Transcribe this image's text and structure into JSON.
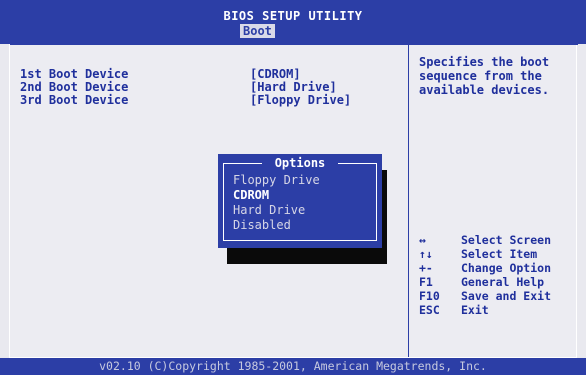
{
  "header": {
    "title": "BIOS SETUP UTILITY",
    "active_tab": "Boot"
  },
  "boot_devices": [
    {
      "label": "1st Boot Device",
      "value": "[CDROM]"
    },
    {
      "label": "2nd Boot Device",
      "value": "[Hard Drive]"
    },
    {
      "label": "3rd Boot Device",
      "value": "[Floppy Drive]"
    }
  ],
  "help": {
    "text": "Specifies the boot sequence from the available devices."
  },
  "keys": [
    {
      "key": "↔",
      "desc": "Select Screen"
    },
    {
      "key": "↑↓",
      "desc": "Select Item"
    },
    {
      "key": "+-",
      "desc": "Change Option"
    },
    {
      "key": "F1",
      "desc": "General Help"
    },
    {
      "key": "F10",
      "desc": "Save and Exit"
    },
    {
      "key": "ESC",
      "desc": "Exit"
    }
  ],
  "popup": {
    "title": "Options",
    "options": [
      {
        "label": "Floppy Drive"
      },
      {
        "label": "CDROM"
      },
      {
        "label": "Hard Drive"
      },
      {
        "label": "Disabled"
      }
    ],
    "selected": "CDROM"
  },
  "footer": {
    "text": "v02.10 (C)Copyright 1985-2001, American Megatrends, Inc."
  },
  "colors": {
    "bios_blue": "#2c3ea6",
    "background": "#ececf2",
    "text_blue": "#1f2f9c",
    "shadow": "#0a0a0a"
  }
}
